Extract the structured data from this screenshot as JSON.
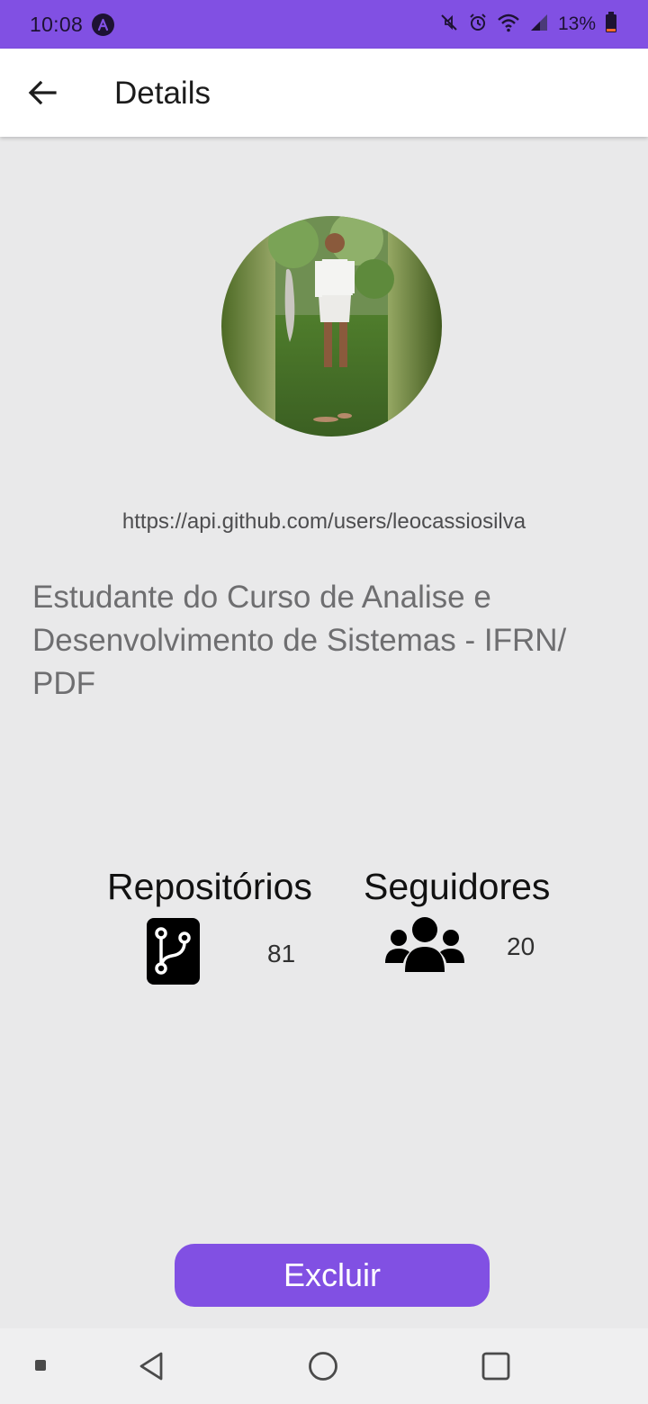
{
  "status_bar": {
    "time": "10:08",
    "battery_percent": "13%",
    "app_icon": "a-logo-icon",
    "icons": [
      "mute-icon",
      "alarm-icon",
      "wifi-icon",
      "cell-signal-icon",
      "battery-icon"
    ],
    "background_color": "#8150e3"
  },
  "app_bar": {
    "title": "Details",
    "back_icon": "arrow-left-icon"
  },
  "profile": {
    "avatar_alt": "profile-photo",
    "url": "https://api.github.com/users/leocassiosilva",
    "bio": "Estudante do Curso de Analise e Desenvolvimento de Sistemas - IFRN/ PDF"
  },
  "stats": {
    "repos_label": "Repositórios",
    "repos_count": "81",
    "repos_icon": "git-branch-icon",
    "followers_label": "Seguidores",
    "followers_count": "20",
    "followers_icon": "users-icon"
  },
  "actions": {
    "delete_label": "Excluir",
    "accent_color": "#8150e3"
  },
  "nav_bar": {
    "buttons": [
      "menu-square-icon",
      "back-triangle-icon",
      "home-circle-icon",
      "recents-square-icon"
    ]
  }
}
